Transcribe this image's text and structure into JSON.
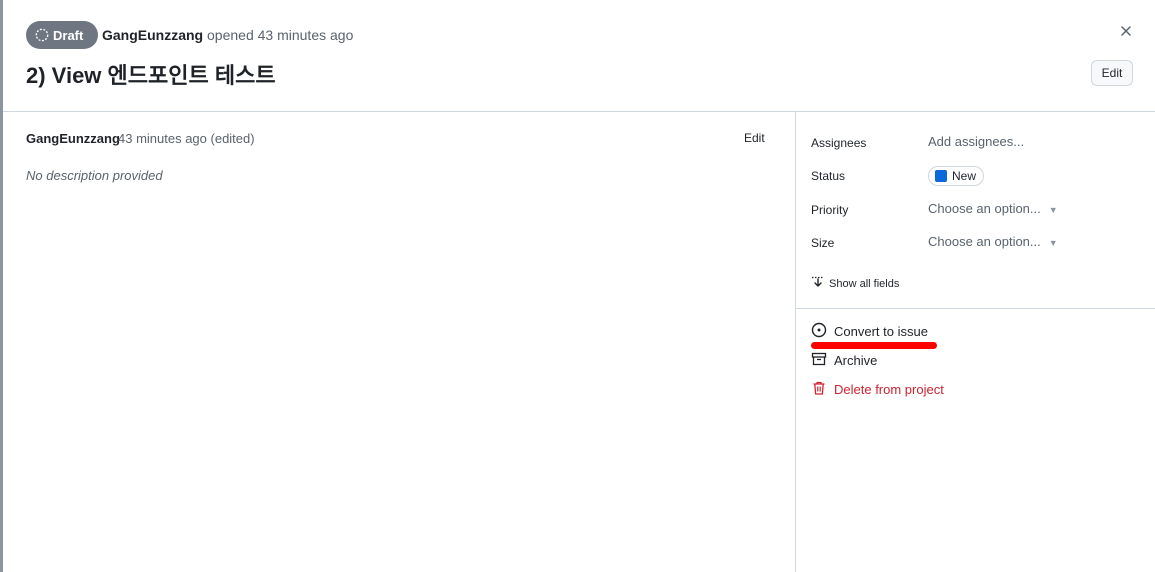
{
  "header": {
    "badge": "Draft",
    "author": "GangEunzzang",
    "opened_text": "opened 43 minutes ago",
    "title": "2) View 엔드포인트 테스트",
    "edit_label": "Edit"
  },
  "comment": {
    "author": "GangEunzzang",
    "time": "43 minutes ago (edited)",
    "edit_label": "Edit",
    "body": "No description provided"
  },
  "sidebar": {
    "assignees": {
      "label": "Assignees",
      "value": "Add assignees..."
    },
    "status": {
      "label": "Status",
      "value": "New",
      "color": "#0969da"
    },
    "priority": {
      "label": "Priority",
      "value": "Choose an option..."
    },
    "size": {
      "label": "Size",
      "value": "Choose an option..."
    },
    "show_all": "Show all fields"
  },
  "actions": {
    "convert": "Convert to issue",
    "archive": "Archive",
    "delete": "Delete from project",
    "danger_color": "#cf222e",
    "highlight_color": "#ff0000"
  }
}
